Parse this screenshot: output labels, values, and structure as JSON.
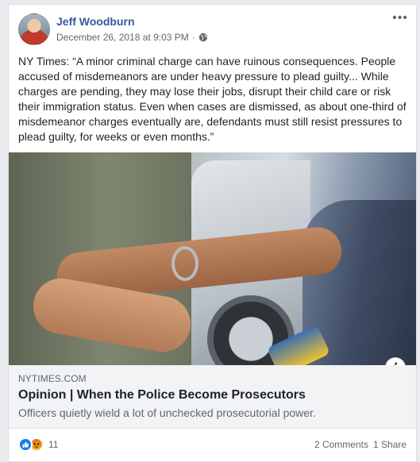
{
  "post": {
    "author": "Jeff Woodburn",
    "timestamp": "December 26, 2018 at 9:03 PM",
    "separator": "·",
    "privacy_icon": "globe-icon",
    "more_icon": "more-options-icon",
    "text": "NY Times: “A minor criminal charge can have ruinous consequences. People accused of misdemeanors are under heavy pressure to plead guilty... While charges are pending, they may lose their jobs, disrupt their child care or risk their immigration status. Even when cases are dismissed, as about one-third of misdemeanor charges eventually are, defendants must still resist pressures to plead guilty, for weeks or even months.”"
  },
  "link": {
    "domain": "NYTIMES.COM",
    "title": "Opinion | When the Police Become Prosecutors",
    "description": "Officers quietly wield a lot of unchecked prosecutorial power.",
    "info_label": "i"
  },
  "footer": {
    "reactions": [
      "like-icon",
      "angry-icon"
    ],
    "reaction_count": "11",
    "comments": "2 Comments",
    "shares": "1 Share"
  },
  "colors": {
    "author_link": "#385898",
    "like_blue": "#1877f2",
    "secondary_text": "#606770"
  }
}
